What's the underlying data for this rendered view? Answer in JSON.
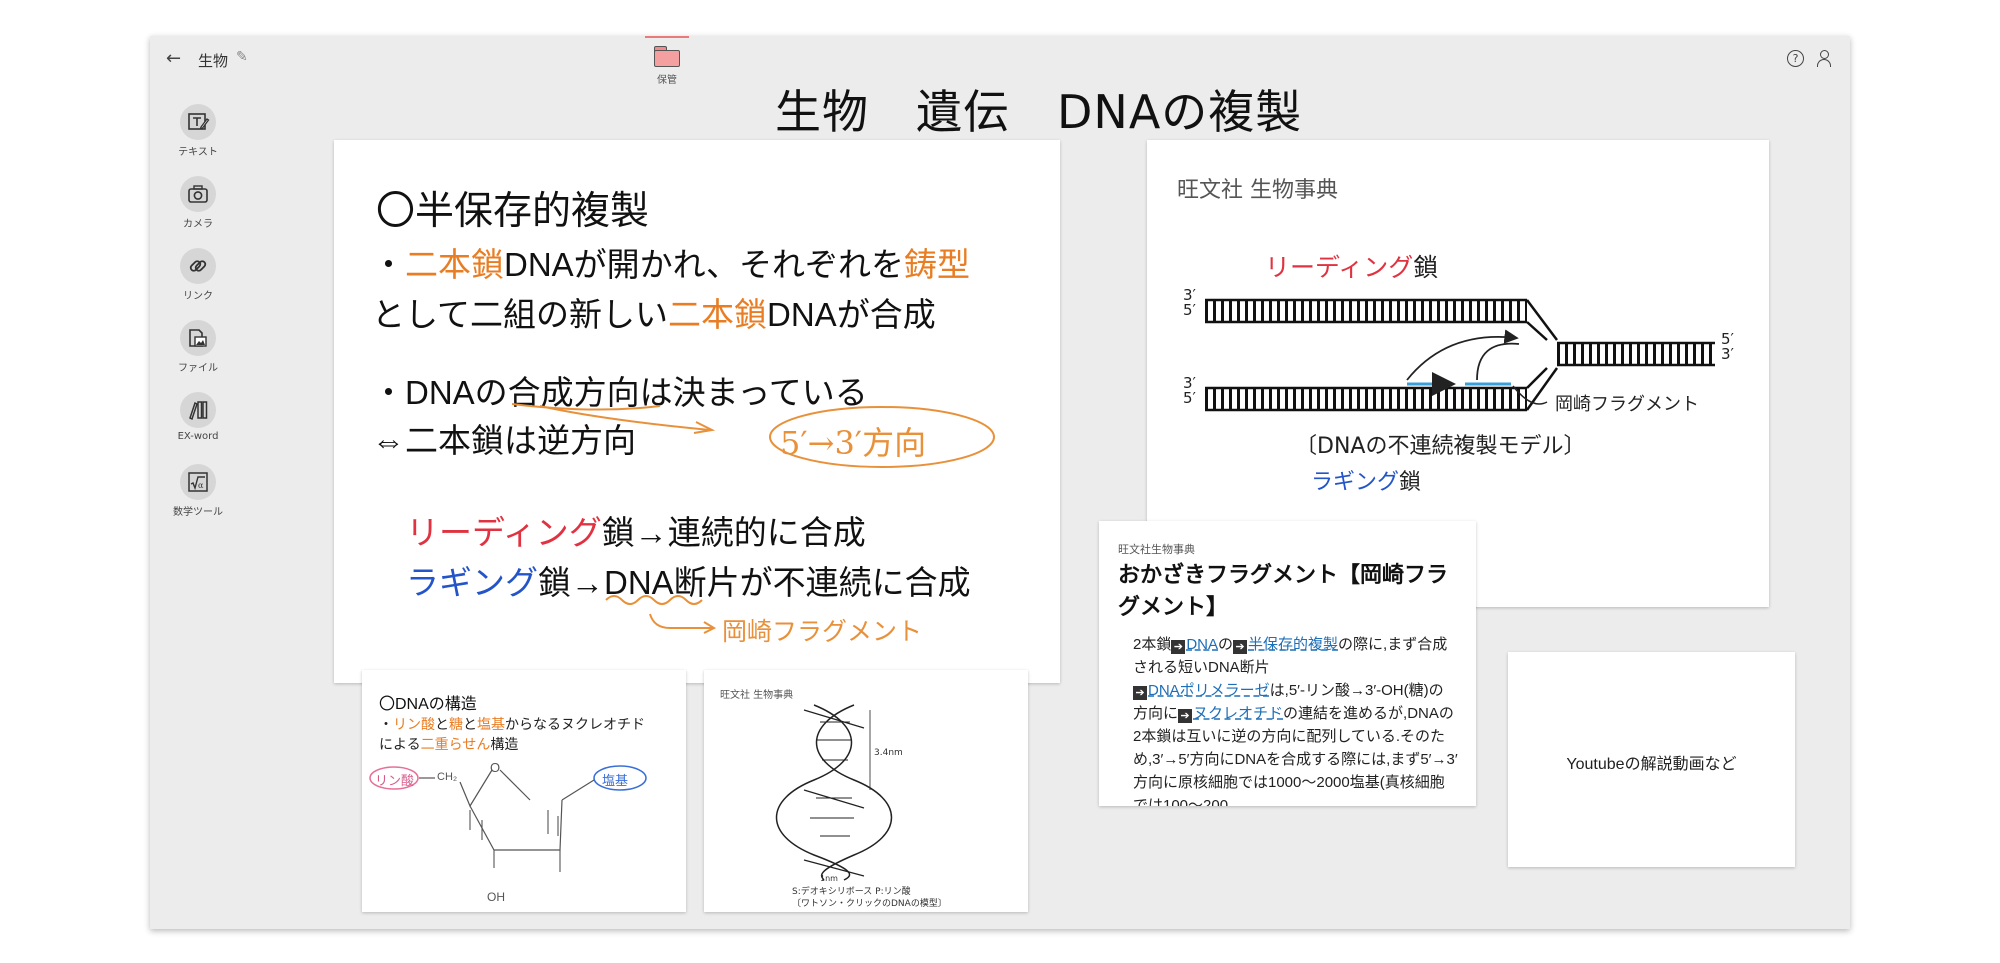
{
  "header": {
    "back_icon": "←",
    "notebook_title": "生物",
    "edit_icon": "✎",
    "archive_label": "保管",
    "help_icon": "?"
  },
  "page_title": "生物　遺伝　DNAの複製",
  "toolbar": [
    {
      "label": "テキスト",
      "icon": "text-edit-icon"
    },
    {
      "label": "カメラ",
      "icon": "camera-icon"
    },
    {
      "label": "リンク",
      "icon": "link-icon"
    },
    {
      "label": "ファイル",
      "icon": "file-icon"
    },
    {
      "label": "EX-word",
      "icon": "dictionary-icon"
    },
    {
      "label": "数学ツール",
      "icon": "math-tool-icon"
    }
  ],
  "main_card": {
    "heading": "〇半保存的複製",
    "line1": {
      "a": "・",
      "b": "二本鎖",
      "c": "DNAが開かれ、それぞれを",
      "d": "鋳型"
    },
    "line2": {
      "a": "として二組の新しい",
      "b": "二本鎖",
      "c": "DNAが合成"
    },
    "line3": "・DNAの合成方向は決まっている",
    "line4": "⇔二本鎖は逆方向",
    "hw_direction": "5′→3′方向",
    "line5": {
      "a": "リーディング",
      "b": "鎖→連続的に合成"
    },
    "line6": {
      "a": "ラギング",
      "b": "鎖→DNA断片が不連続に合成"
    },
    "hw_fragment": "岡崎フラグメント"
  },
  "ref_card": {
    "source": "旺文社 生物事典",
    "leading": {
      "a": "リーディング",
      "b": "鎖"
    },
    "lagging": {
      "a": "ラギング",
      "b": "鎖"
    },
    "top_left_3": "3′",
    "top_left_5": "5′",
    "bot_left_3": "3′",
    "bot_left_5": "5′",
    "right_5": "5′",
    "right_3": "3′",
    "fragment_label": "岡崎フラグメント",
    "caption": "〔DNAの不連続複製モデル〕"
  },
  "dict_card": {
    "source": "旺文社生物事典",
    "title": "おかざきフラグメント【岡崎フラグメント】",
    "body": {
      "p1": "2本鎖",
      "link_dna": "DNA",
      "p2": "の",
      "link_semi": "半保存的複製",
      "p3": "の際に,まず合成される短いDNA断片",
      "link_pol": "DNAポリメラーゼ",
      "p4": "は,5′-リン酸→3′-OH(糖)の方向に",
      "link_nuc": "ヌクレオチド",
      "p5": "の連結を進めるが,DNAの2本鎖は互いに逆の方向に配列している.そのため,3′→5′方向にDNAを合成する際には,まず5′→3′方向に原核細胞では1000〜2000塩基(真核細胞では100〜200"
    }
  },
  "structure_card": {
    "title": "〇DNAの構造",
    "line1": {
      "a": "・",
      "b": "リン酸",
      "c": "と",
      "d": "糖",
      "e": "と",
      "f": "塩基",
      "g": "からなるヌクレオチド"
    },
    "line2": {
      "a": "による",
      "b": "二重らせん",
      "c": "構造"
    },
    "hw_phosphate": "リン酸",
    "hw_base": "塩基",
    "hw_ch2": "CH₂",
    "hw_o": "O",
    "hw_oh": "OH"
  },
  "helix_card": {
    "source": "旺文社 生物事典",
    "pitch": "3.4nm",
    "width": "1nm",
    "caption1": "S:デオキシリボース P:リン酸",
    "caption2": "〔ワトソン・クリックのDNAの模型〕"
  },
  "video_card": {
    "text": "Youtubeの解説動画など"
  }
}
